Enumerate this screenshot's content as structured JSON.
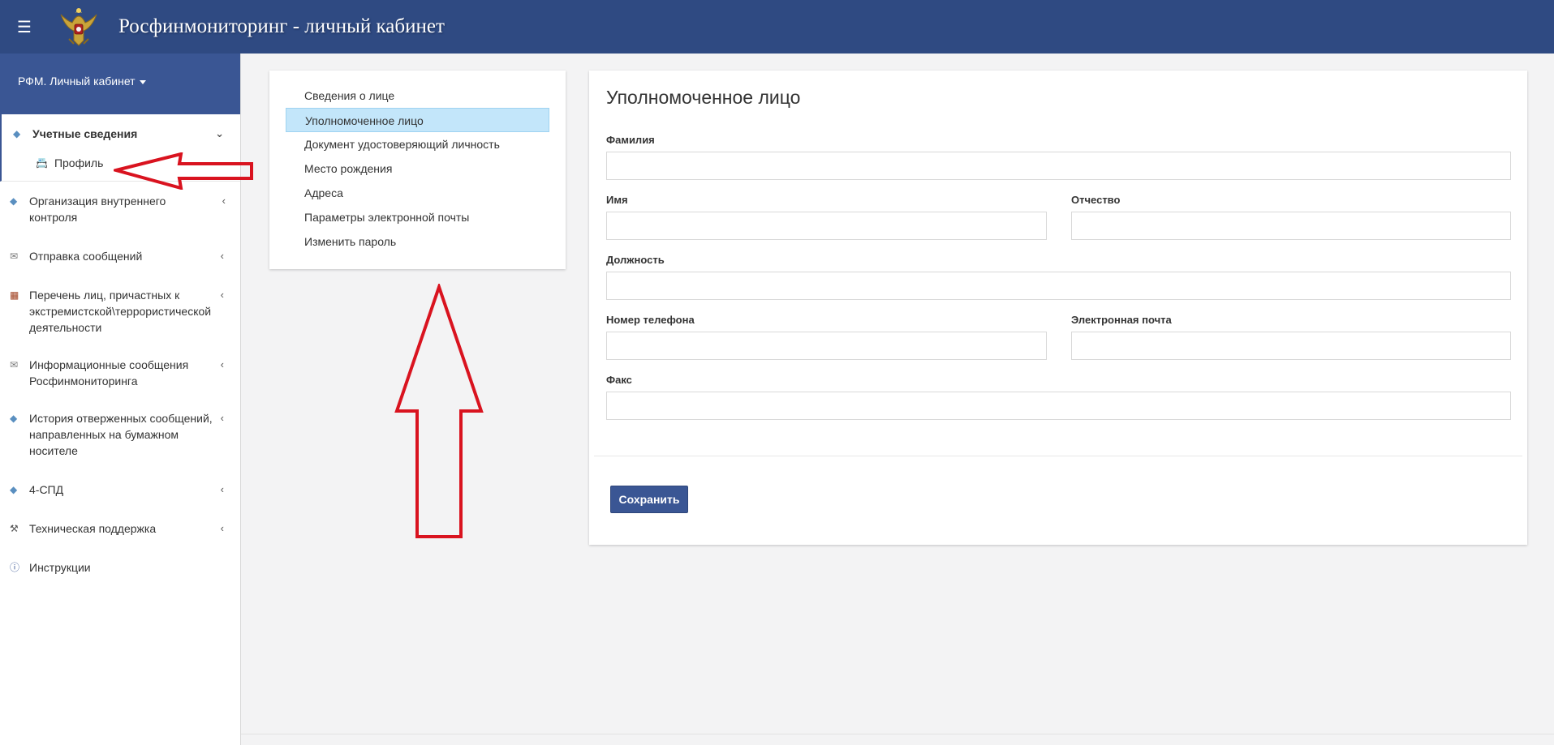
{
  "header": {
    "title": "Росфинмониторинг - личный кабинет",
    "menu_icon": "hamburger-icon",
    "logo_icon": "double-headed-eagle-emblem"
  },
  "sidebar": {
    "account_label": "РФМ. Личный кабинет",
    "items": [
      {
        "label": "Учетные сведения",
        "icon": "diamond-icon",
        "expanded": true,
        "children": [
          {
            "label": "Профиль",
            "icon": "id-card-icon"
          }
        ]
      },
      {
        "label": "Организация внутреннего контроля",
        "icon": "diamond-icon"
      },
      {
        "label": "Отправка сообщений",
        "icon": "envelope-icon"
      },
      {
        "label": "Перечень лиц, причастных к экстремистской\\террористической деятельности",
        "icon": "building-icon"
      },
      {
        "label": "Информационные сообщения Росфинмониторинга",
        "icon": "envelope-icon"
      },
      {
        "label": "История отверженных сообщений, направленных на бумажном носителе",
        "icon": "diamond-icon"
      },
      {
        "label": "4-СПД",
        "icon": "diamond-icon"
      },
      {
        "label": "Техническая поддержка",
        "icon": "tools-icon"
      },
      {
        "label": "Инструкции",
        "icon": "info-icon"
      }
    ]
  },
  "submenu": {
    "items": [
      "Сведения о лице",
      "Уполномоченное лицо",
      "Документ удостоверяющий личность",
      "Место рождения",
      "Адреса",
      "Параметры электронной почты",
      "Изменить пароль"
    ],
    "selected_index": 1
  },
  "form": {
    "title": "Уполномоченное лицо",
    "fields": {
      "surname": {
        "label": "Фамилия",
        "value": ""
      },
      "name": {
        "label": "Имя",
        "value": ""
      },
      "patronymic": {
        "label": "Отчество",
        "value": ""
      },
      "position": {
        "label": "Должность",
        "value": ""
      },
      "phone": {
        "label": "Номер телефона",
        "value": ""
      },
      "email": {
        "label": "Электронная почта",
        "value": ""
      },
      "fax": {
        "label": "Факс",
        "value": ""
      }
    },
    "save_label": "Сохранить"
  },
  "colors": {
    "header_bg": "#2f4a82",
    "accent": "#3a5694",
    "selected_bg": "#c3e6fa",
    "annotation": "#d9131f"
  }
}
